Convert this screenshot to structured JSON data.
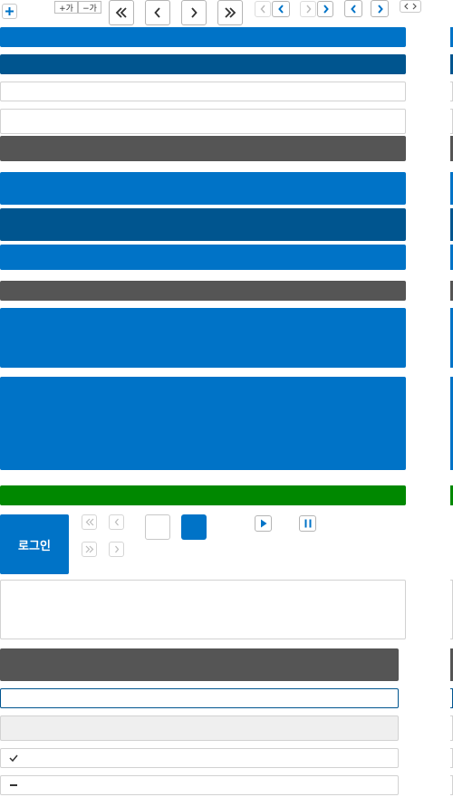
{
  "toolbar": {
    "font_increase_label": "+가",
    "font_decrease_label": "−가",
    "icons": {
      "plus": "plus-icon",
      "first": "double-chevron-left-icon",
      "prev": "chevron-left-icon",
      "next": "chevron-right-icon",
      "last": "double-chevron-right-icon"
    }
  },
  "colors": {
    "primary": "#0073c7",
    "primary_dark": "#00558f",
    "secondary": "#555555",
    "success": "#008800",
    "border": "#d2d2d2",
    "disabled_bg": "#efefef",
    "focus_border": "#00558f"
  },
  "login": {
    "label": "로그인"
  },
  "media": {
    "play": "play-icon",
    "pause": "pause-icon"
  }
}
